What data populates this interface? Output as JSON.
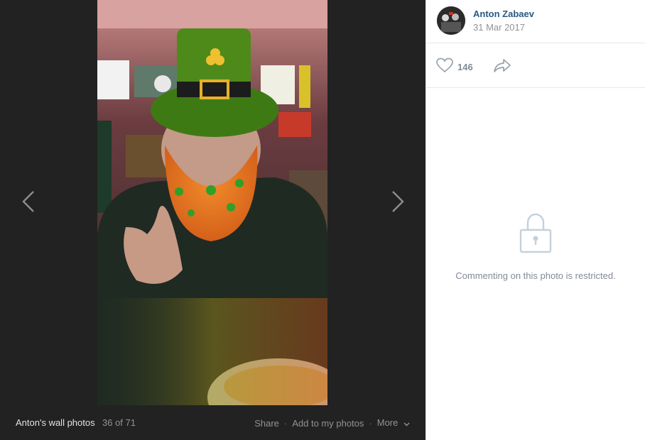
{
  "viewer": {
    "album_label": "Anton's wall photos",
    "counter": "36 of 71",
    "actions": {
      "share": "Share",
      "add": "Add to my photos",
      "more": "More"
    },
    "separator": "·"
  },
  "post": {
    "author": "Anton Zabaev",
    "date": "31 Mar 2017",
    "likes": "146"
  },
  "comments": {
    "restricted_text": "Commenting on this photo is restricted."
  },
  "icons": {
    "prev": "chevron-left-icon",
    "next": "chevron-right-icon",
    "like": "heart-icon",
    "share": "share-arrow-icon",
    "lock": "lock-icon",
    "more": "chevron-down-icon"
  },
  "colors": {
    "link": "#2a5885",
    "viewer_bg": "#222222",
    "muted": "#828a99"
  }
}
